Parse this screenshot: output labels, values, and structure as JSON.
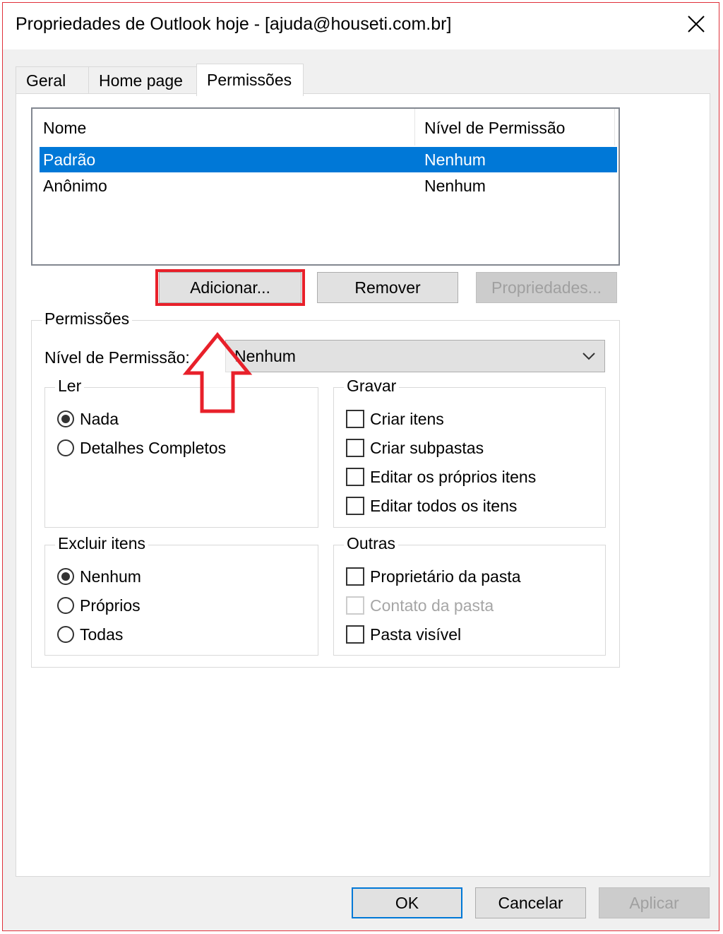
{
  "window": {
    "title": "Propriedades de Outlook hoje - [ajuda@houseti.com.br]"
  },
  "tabs": [
    {
      "label": "Geral"
    },
    {
      "label": "Home page"
    },
    {
      "label": "Permissões"
    }
  ],
  "list": {
    "columns": [
      "Nome",
      "Nível de Permissão"
    ],
    "rows": [
      {
        "name": "Padrão",
        "level": "Nenhum",
        "selected": true
      },
      {
        "name": "Anônimo",
        "level": "Nenhum",
        "selected": false
      }
    ]
  },
  "list_buttons": {
    "add": "Adicionar...",
    "remove": "Remover",
    "properties": "Propriedades..."
  },
  "permissions": {
    "group_label": "Permissões",
    "level_label": "Nível de Permissão:",
    "level_value": "Nenhum",
    "read": {
      "label": "Ler",
      "options": [
        {
          "label": "Nada",
          "checked": true
        },
        {
          "label": "Detalhes Completos",
          "checked": false
        }
      ]
    },
    "write": {
      "label": "Gravar",
      "options": [
        {
          "label": "Criar itens",
          "checked": false
        },
        {
          "label": "Criar subpastas",
          "checked": false
        },
        {
          "label": "Editar os próprios itens",
          "checked": false
        },
        {
          "label": "Editar todos os itens",
          "checked": false
        }
      ]
    },
    "delete": {
      "label": "Excluir itens",
      "options": [
        {
          "label": "Nenhum",
          "checked": true
        },
        {
          "label": "Próprios",
          "checked": false
        },
        {
          "label": "Todas",
          "checked": false
        }
      ]
    },
    "other": {
      "label": "Outras",
      "options": [
        {
          "label": "Proprietário da pasta",
          "checked": false
        },
        {
          "label": "Contato da pasta",
          "checked": false,
          "disabled": true
        },
        {
          "label": "Pasta visível",
          "checked": false
        }
      ]
    }
  },
  "footer": {
    "ok": "OK",
    "cancel": "Cancelar",
    "apply": "Aplicar"
  },
  "colors": {
    "selection": "#0078d7",
    "annotation": "#e8202a"
  },
  "icons": {
    "close": "close-icon",
    "dropdown": "chevron-down-icon",
    "annotation": "up-arrow-icon"
  }
}
